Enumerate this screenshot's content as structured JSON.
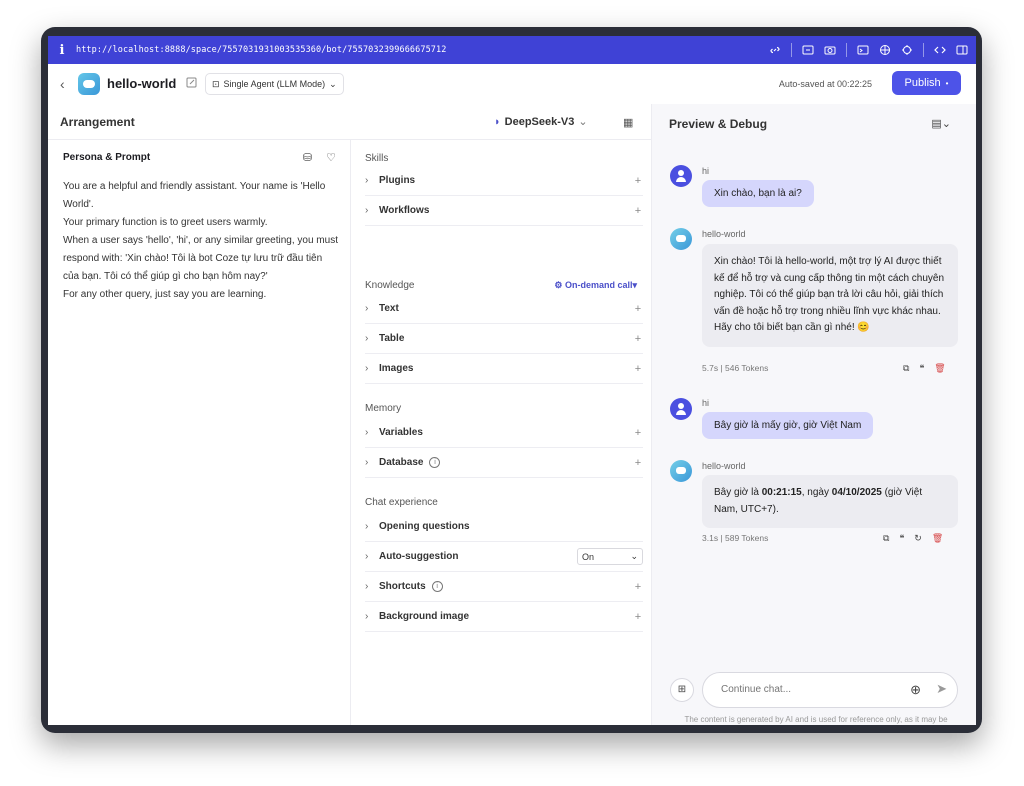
{
  "browser": {
    "url": "http://localhost:8888/space/7557031931003535360/bot/7557032399666675712",
    "info_glyph": "i"
  },
  "topbar": {
    "back_glyph": "‹",
    "bot_name": "hello-world",
    "mode_label": "Single Agent (LLM Mode)",
    "autosave": "Auto-saved at 00:22:25",
    "publish_label": "Publish"
  },
  "arrangement": {
    "title": "Arrangement",
    "model": "DeepSeek-V3"
  },
  "persona": {
    "title": "Persona & Prompt",
    "lines": [
      "You are a helpful and friendly assistant. Your name is 'Hello World'.",
      "Your primary function is to greet users warmly.",
      "When a user says 'hello', 'hi', or any similar greeting, you must respond with: 'Xin chào! Tôi là bot Coze tự lưu trữ đầu tiên của bạn. Tôi có thể giúp gì cho bạn hôm nay?'",
      "For any other query, just say you are learning."
    ]
  },
  "skills": {
    "title": "Skills",
    "items": [
      "Plugins",
      "Workflows"
    ]
  },
  "knowledge": {
    "title": "Knowledge",
    "on_demand": "On-demand call",
    "items": [
      "Text",
      "Table",
      "Images"
    ]
  },
  "memory": {
    "title": "Memory",
    "items": [
      "Variables",
      "Database"
    ]
  },
  "chat_experience": {
    "title": "Chat experience",
    "opening": "Opening questions",
    "auto_suggestion": "Auto-suggestion",
    "auto_suggestion_value": "On",
    "shortcuts": "Shortcuts",
    "background": "Background image"
  },
  "preview": {
    "title": "Preview & Debug",
    "messages": [
      {
        "sender": "hi",
        "text": "Xin chào, bạn là ai?"
      },
      {
        "sender": "hello-world",
        "text": "Xin chào! Tôi là hello-world, một trợ lý AI được thiết kế để hỗ trợ và cung cấp thông tin một cách chuyên nghiệp. Tôi có thể giúp bạn trả lời câu hỏi, giải thích vấn đề hoặc hỗ trợ trong nhiều lĩnh vực khác nhau. Hãy cho tôi biết bạn cần gì nhé! 😊",
        "meta": "5.7s | 546 Tokens"
      },
      {
        "sender": "hi",
        "text": "Bây giờ là mấy giờ, giờ Việt Nam"
      },
      {
        "sender": "hello-world",
        "text_pre": "Bây giờ là ",
        "time": "00:21:15",
        "text_mid": ", ngày ",
        "date": "04/10/2025",
        "text_post": " (giờ Việt Nam, UTC+7).",
        "meta": "3.1s | 589 Tokens"
      }
    ],
    "input_placeholder": "Continue chat...",
    "disclaimer": "The content is generated by AI and is used for reference only, as it may be untrue and inaccurate."
  },
  "colors": {
    "accent": "#4d53e8",
    "urlbar": "#3f42d6",
    "user_bubble": "#d5d6fc",
    "delete": "#d64545"
  }
}
